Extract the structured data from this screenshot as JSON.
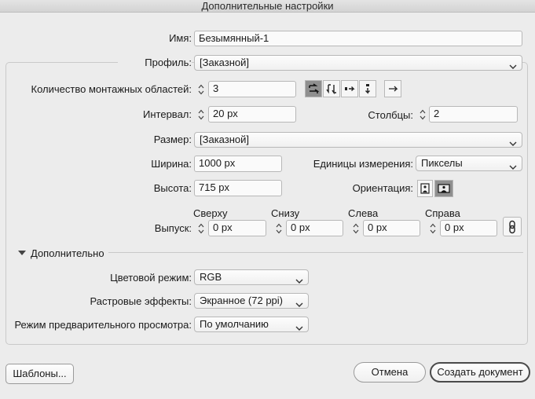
{
  "window": {
    "title": "Дополнительные настройки"
  },
  "name": {
    "label": "Имя:",
    "value": "Безымянный-1"
  },
  "profile": {
    "label": "Профиль:",
    "value": "[Заказной]"
  },
  "artboards": {
    "label": "Количество монтажных областей:",
    "value": "3",
    "layout_icons": [
      "grid-by-row-icon",
      "grid-by-column-icon",
      "arrange-by-row-icon",
      "arrange-by-column-icon",
      "arrow-right-icon"
    ]
  },
  "spacing": {
    "label": "Интервал:",
    "value": "20 px"
  },
  "columns": {
    "label": "Столбцы:",
    "value": "2"
  },
  "size": {
    "label": "Размер:",
    "value": "[Заказной]"
  },
  "width": {
    "label": "Ширина:",
    "value": "1000 px"
  },
  "units": {
    "label": "Единицы измерения:",
    "value": "Пикселы"
  },
  "height": {
    "label": "Высота:",
    "value": "715 px"
  },
  "orientation": {
    "label": "Ориентация:",
    "selected": "landscape"
  },
  "bleed": {
    "label": "Выпуск:",
    "top_label": "Сверху",
    "top_value": "0 px",
    "bottom_label": "Снизу",
    "bottom_value": "0 px",
    "left_label": "Слева",
    "left_value": "0 px",
    "right_label": "Справа",
    "right_value": "0 px"
  },
  "advanced": {
    "label": "Дополнительно",
    "color_mode_label": "Цветовой режим:",
    "color_mode_value": "RGB",
    "raster_label": "Растровые эффекты:",
    "raster_value": "Экранное (72 ppi)",
    "preview_label": "Режим предварительного просмотра:",
    "preview_value": "По умолчанию"
  },
  "buttons": {
    "templates": "Шаблоны...",
    "cancel": "Отмена",
    "create": "Создать документ"
  }
}
